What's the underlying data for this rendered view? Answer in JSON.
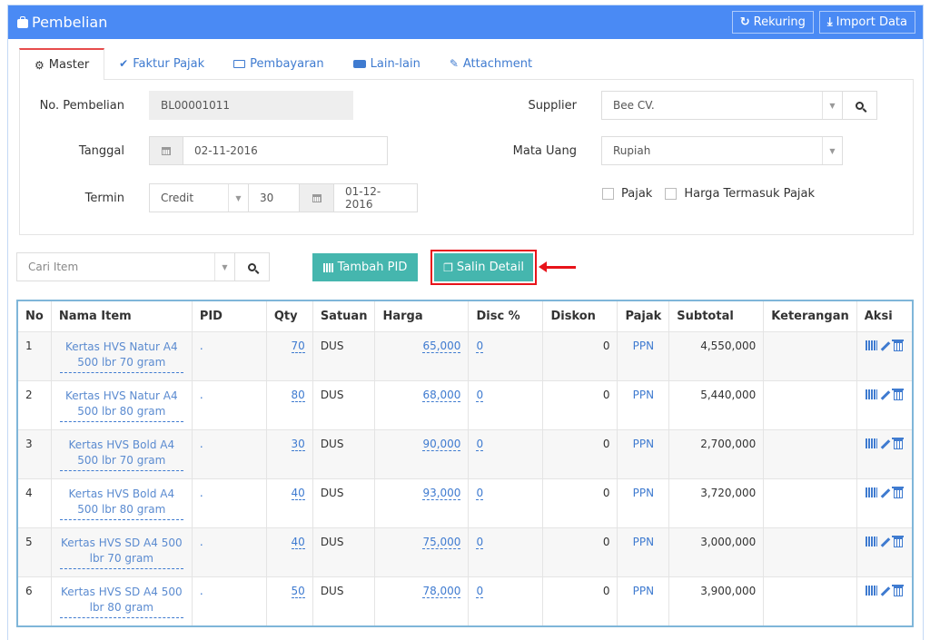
{
  "header": {
    "title": "Pembelian",
    "buttons": {
      "rekuring": "Rekuring",
      "import": "Import Data"
    }
  },
  "tabs": [
    {
      "label": "Master",
      "icon": "cogs-icon",
      "active": true
    },
    {
      "label": "Faktur Pajak",
      "icon": "check-circle-icon",
      "active": false
    },
    {
      "label": "Pembayaran",
      "icon": "money-icon",
      "active": false
    },
    {
      "label": "Lain-lain",
      "icon": "truck-icon",
      "active": false
    },
    {
      "label": "Attachment",
      "icon": "paperclip-icon",
      "active": false
    }
  ],
  "form": {
    "no_pembelian": {
      "label": "No. Pembelian",
      "value": "BL00001011"
    },
    "tanggal": {
      "label": "Tanggal",
      "value": "02-11-2016"
    },
    "termin": {
      "label": "Termin",
      "type": "Credit",
      "days": "30",
      "due_date": "01-12-2016"
    },
    "supplier": {
      "label": "Supplier",
      "value": "Bee CV."
    },
    "mata_uang": {
      "label": "Mata Uang",
      "value": "Rupiah"
    },
    "pajak": {
      "label": "Pajak",
      "checked": false
    },
    "harga_termasuk_pajak": {
      "label": "Harga Termasuk Pajak",
      "checked": false
    }
  },
  "toolbar": {
    "search_placeholder": "Cari Item",
    "tambah_pid": "Tambah PID",
    "salin_detail": "Salin Detail"
  },
  "table": {
    "columns": [
      "No",
      "Nama Item",
      "PID",
      "Qty",
      "Satuan",
      "Harga",
      "Disc %",
      "Diskon",
      "Pajak",
      "Subtotal",
      "Keterangan",
      "Aksi"
    ],
    "rows": [
      {
        "no": "1",
        "nama": "Kertas HVS Natur A4 500 lbr 70 gram",
        "pid": ".",
        "qty": "70",
        "satuan": "DUS",
        "harga": "65,000",
        "disc": "0",
        "diskon": "0",
        "pajak": "PPN",
        "subtotal": "4,550,000",
        "keterangan": ""
      },
      {
        "no": "2",
        "nama": "Kertas HVS Natur A4 500 lbr 80 gram",
        "pid": ".",
        "qty": "80",
        "satuan": "DUS",
        "harga": "68,000",
        "disc": "0",
        "diskon": "0",
        "pajak": "PPN",
        "subtotal": "5,440,000",
        "keterangan": ""
      },
      {
        "no": "3",
        "nama": "Kertas HVS Bold A4 500 lbr 70 gram",
        "pid": ".",
        "qty": "30",
        "satuan": "DUS",
        "harga": "90,000",
        "disc": "0",
        "diskon": "0",
        "pajak": "PPN",
        "subtotal": "2,700,000",
        "keterangan": ""
      },
      {
        "no": "4",
        "nama": "Kertas HVS Bold A4 500 lbr 80 gram",
        "pid": ".",
        "qty": "40",
        "satuan": "DUS",
        "harga": "93,000",
        "disc": "0",
        "diskon": "0",
        "pajak": "PPN",
        "subtotal": "3,720,000",
        "keterangan": ""
      },
      {
        "no": "5",
        "nama": "Kertas HVS SD A4 500 lbr 70 gram",
        "pid": ".",
        "qty": "40",
        "satuan": "DUS",
        "harga": "75,000",
        "disc": "0",
        "diskon": "0",
        "pajak": "PPN",
        "subtotal": "3,000,000",
        "keterangan": ""
      },
      {
        "no": "6",
        "nama": "Kertas HVS SD A4 500 lbr 80 gram",
        "pid": ".",
        "qty": "50",
        "satuan": "DUS",
        "harga": "78,000",
        "disc": "0",
        "diskon": "0",
        "pajak": "PPN",
        "subtotal": "3,900,000",
        "keterangan": ""
      }
    ]
  },
  "colors": {
    "header_bg": "#4a8af4",
    "teal_button": "#45b6ae",
    "highlight": "#e8131a",
    "link": "#3f7bd0",
    "active_tab_border": "#e74c4c"
  }
}
